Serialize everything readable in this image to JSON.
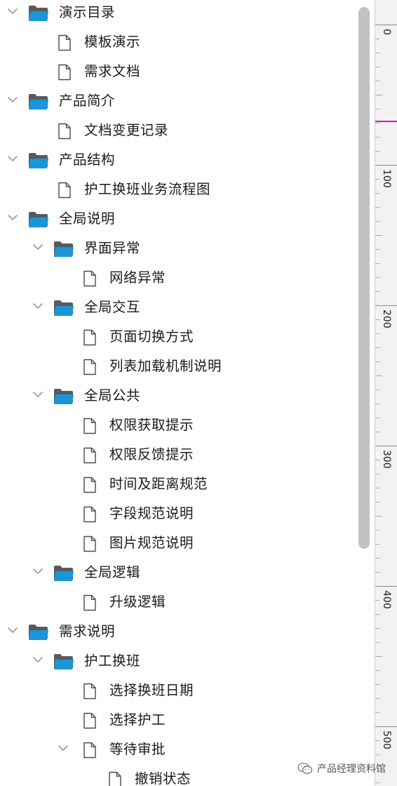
{
  "tree": [
    {
      "level": 0,
      "type": "folder",
      "label": "演示目录",
      "expanded": true
    },
    {
      "level": 1,
      "type": "page",
      "label": "模板演示"
    },
    {
      "level": 1,
      "type": "page",
      "label": "需求文档"
    },
    {
      "level": 0,
      "type": "folder",
      "label": "产品简介",
      "expanded": true
    },
    {
      "level": 1,
      "type": "page",
      "label": "文档变更记录"
    },
    {
      "level": 0,
      "type": "folder",
      "label": "产品结构",
      "expanded": true
    },
    {
      "level": 1,
      "type": "page",
      "label": "护工换班业务流程图"
    },
    {
      "level": 0,
      "type": "folder",
      "label": "全局说明",
      "expanded": true
    },
    {
      "level": 1,
      "type": "folder",
      "label": "界面异常",
      "expanded": true
    },
    {
      "level": 2,
      "type": "page",
      "label": "网络异常"
    },
    {
      "level": 1,
      "type": "folder",
      "label": "全局交互",
      "expanded": true
    },
    {
      "level": 2,
      "type": "page",
      "label": "页面切换方式"
    },
    {
      "level": 2,
      "type": "page",
      "label": "列表加载机制说明"
    },
    {
      "level": 1,
      "type": "folder",
      "label": "全局公共",
      "expanded": true
    },
    {
      "level": 2,
      "type": "page",
      "label": "权限获取提示"
    },
    {
      "level": 2,
      "type": "page",
      "label": "权限反馈提示"
    },
    {
      "level": 2,
      "type": "page",
      "label": "时间及距离规范"
    },
    {
      "level": 2,
      "type": "page",
      "label": "字段规范说明"
    },
    {
      "level": 2,
      "type": "page",
      "label": "图片规范说明"
    },
    {
      "level": 1,
      "type": "folder",
      "label": "全局逻辑",
      "expanded": true
    },
    {
      "level": 2,
      "type": "page",
      "label": "升级逻辑"
    },
    {
      "level": 0,
      "type": "folder",
      "label": "需求说明",
      "expanded": true
    },
    {
      "level": 1,
      "type": "folder",
      "label": "护工换班",
      "expanded": true
    },
    {
      "level": 2,
      "type": "page",
      "label": "选择换班日期"
    },
    {
      "level": 2,
      "type": "page",
      "label": "选择护工"
    },
    {
      "level": 2,
      "type": "page",
      "label": "等待审批",
      "expanded": true
    },
    {
      "level": 3,
      "type": "page",
      "label": "撤销状态"
    }
  ],
  "ruler": {
    "labels": [
      "0",
      "100",
      "200",
      "300",
      "400",
      "500"
    ]
  },
  "watermark": {
    "text": "产品经理资料馆"
  },
  "colors": {
    "folder": "#1a96d8",
    "folder_back": "#5a5a5a",
    "marker": "#e000c8",
    "scroll_thumb": "#c2c2c2"
  }
}
